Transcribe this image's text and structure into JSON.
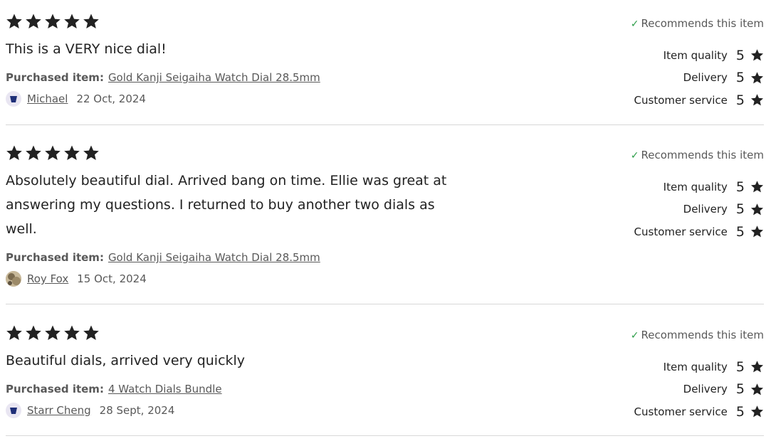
{
  "reviews": [
    {
      "stars": 5,
      "text": "This is a VERY nice dial!",
      "purchased_label": "Purchased item:",
      "item": "Gold Kanji Seigaiha Watch Dial 28.5mm",
      "reviewer": "Michael",
      "date": "22 Oct, 2024",
      "avatar": "blue-shape-avatar",
      "recommends": "Recommends this item",
      "ratings": [
        {
          "label": "Item quality",
          "value": "5"
        },
        {
          "label": "Delivery",
          "value": "5"
        },
        {
          "label": "Customer service",
          "value": "5"
        }
      ]
    },
    {
      "stars": 5,
      "text": "Absolutely beautiful dial. Arrived bang on time. Ellie was great at answering my questions. I returned to buy another two dials as well.",
      "purchased_label": "Purchased item:",
      "item": "Gold Kanji Seigaiha Watch Dial 28.5mm",
      "reviewer": "Roy Fox",
      "date": "15 Oct, 2024",
      "avatar": "photo-avatar",
      "recommends": "Recommends this item",
      "ratings": [
        {
          "label": "Item quality",
          "value": "5"
        },
        {
          "label": "Delivery",
          "value": "5"
        },
        {
          "label": "Customer service",
          "value": "5"
        }
      ]
    },
    {
      "stars": 5,
      "text": "Beautiful dials, arrived very quickly",
      "purchased_label": "Purchased item:",
      "item": "4 Watch Dials Bundle",
      "reviewer": "Starr Cheng",
      "date": "28 Sept, 2024",
      "avatar": "blue-shape-avatar",
      "recommends": "Recommends this item",
      "ratings": [
        {
          "label": "Item quality",
          "value": "5"
        },
        {
          "label": "Delivery",
          "value": "5"
        },
        {
          "label": "Customer service",
          "value": "5"
        }
      ]
    }
  ],
  "colors": {
    "text": "#222222",
    "muted": "#595959",
    "check": "#2e9e4a",
    "divider": "#d8d8d8"
  }
}
